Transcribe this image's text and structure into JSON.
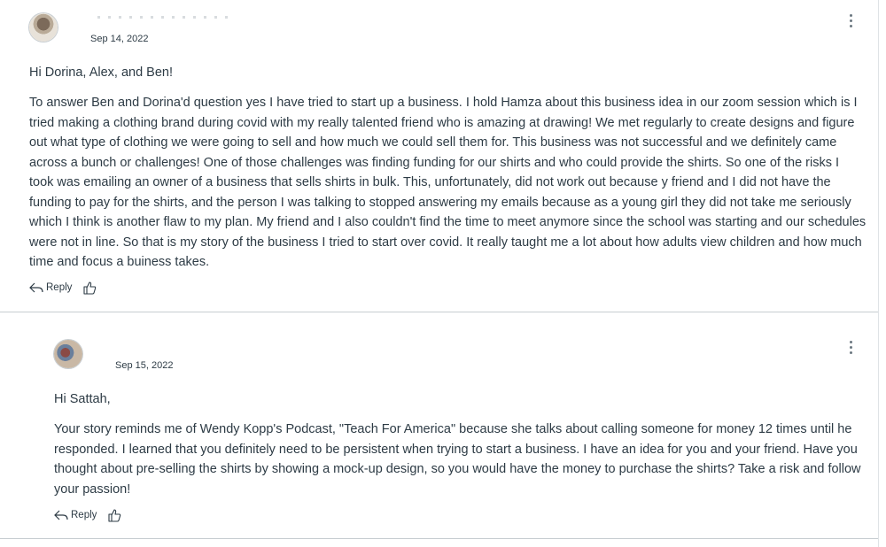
{
  "posts": [
    {
      "author": "",
      "date": "Sep 14, 2022",
      "greeting": "Hi Dorina, Alex, and Ben!",
      "body": "To answer Ben and Dorina'd question yes I have tried to start up a business. I hold Hamza about this business idea in our zoom session which is I tried making a clothing brand during covid with my really talented friend who is amazing at drawing! We met regularly to create designs and figure out what type of clothing we were going to sell and how much we could sell them for. This business was not successful and we definitely came across a bunch or challenges! One of those challenges was finding funding for our shirts and who could provide the shirts. So one of the risks I took was emailing an owner of a business that sells shirts in bulk. This, unfortunately, did not work out because y friend and I did not have the funding to pay for the shirts, and the person I was talking to stopped answering my emails because as a young girl they did not take me seriously which I think is another flaw to my plan. My friend and I also couldn't find the time to meet anymore since the school was starting and our schedules were not in line. So that is my story of the business I tried to start over covid. It really taught me a lot about how adults view children and how much time and focus a buiness takes.",
      "reply_label": "Reply",
      "icons": [
        "reply-arrow-icon",
        "thumbs-up-icon",
        "more-options-icon"
      ]
    },
    {
      "author": "",
      "date": "Sep 15, 2022",
      "greeting": "Hi Sattah,",
      "body": "Your story reminds me of Wendy Kopp's Podcast, \"Teach For America\" because she talks about calling someone for money 12 times until he responded. I learned that you definitely need to be persistent when trying to start a business.  I have an idea for you and your friend. Have you thought about pre-selling the shirts by showing a mock-up design, so you would have the money to purchase the shirts? Take a risk and follow your passion!",
      "reply_label": "Reply",
      "icons": [
        "reply-arrow-icon",
        "thumbs-up-icon",
        "more-options-icon"
      ]
    }
  ],
  "colors": {
    "text": "#2d3b45",
    "divider": "#c7cdd1",
    "icon": "#6b7780"
  }
}
